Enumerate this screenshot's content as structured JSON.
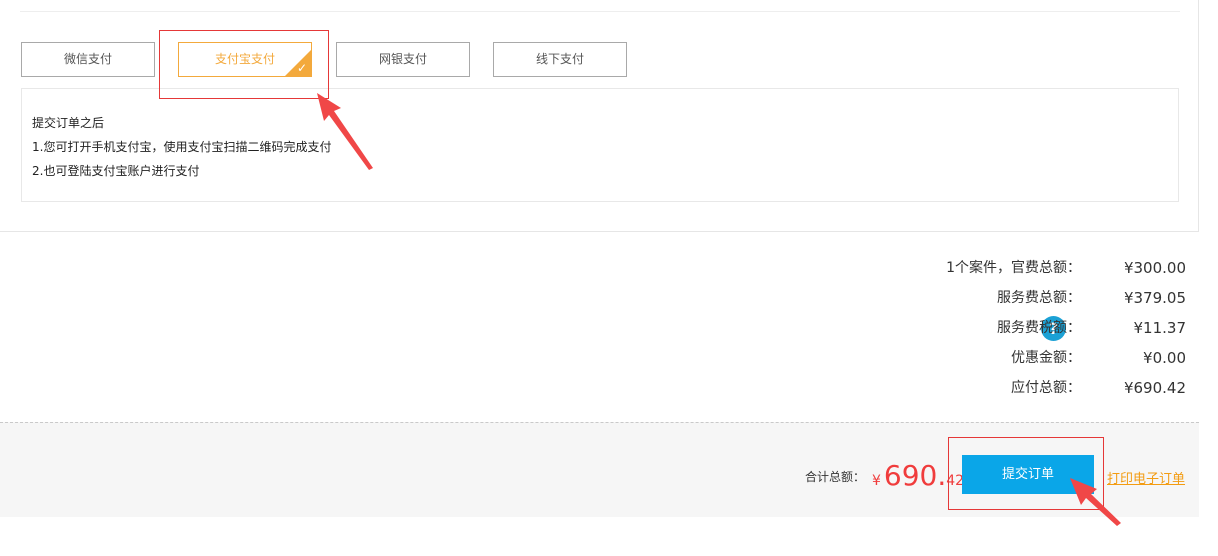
{
  "payment": {
    "methods": [
      {
        "label": "微信支付",
        "selected": false
      },
      {
        "label": "支付宝支付",
        "selected": true
      },
      {
        "label": "网银支付",
        "selected": false
      },
      {
        "label": "线下支付",
        "selected": false
      }
    ],
    "instructions": [
      "提交订单之后",
      "1.您可打开手机支付宝，使用支付宝扫描二维码完成支付",
      "2.也可登陆支付宝账户进行支付"
    ],
    "accent_color": "#f3a93c"
  },
  "summary": {
    "rows": [
      {
        "label": "1个案件，官费总额：",
        "value": "¥300.00"
      },
      {
        "label": "服务费总额：",
        "value": "¥379.05"
      },
      {
        "label": "服务费税额：",
        "value": "¥11.37",
        "icon": "question-icon"
      },
      {
        "label": "优惠金额：",
        "value": "¥0.00"
      },
      {
        "label": "应付总额：",
        "value": "¥690.42"
      }
    ]
  },
  "footer": {
    "total_label": "合计总额：",
    "total_currency": "¥",
    "total_integer": "690.",
    "total_decimal": "42",
    "submit_label": "提交订单",
    "print_label": "打印电子订单",
    "submit_color": "#0aa6e8",
    "total_color": "#f03c3c"
  }
}
